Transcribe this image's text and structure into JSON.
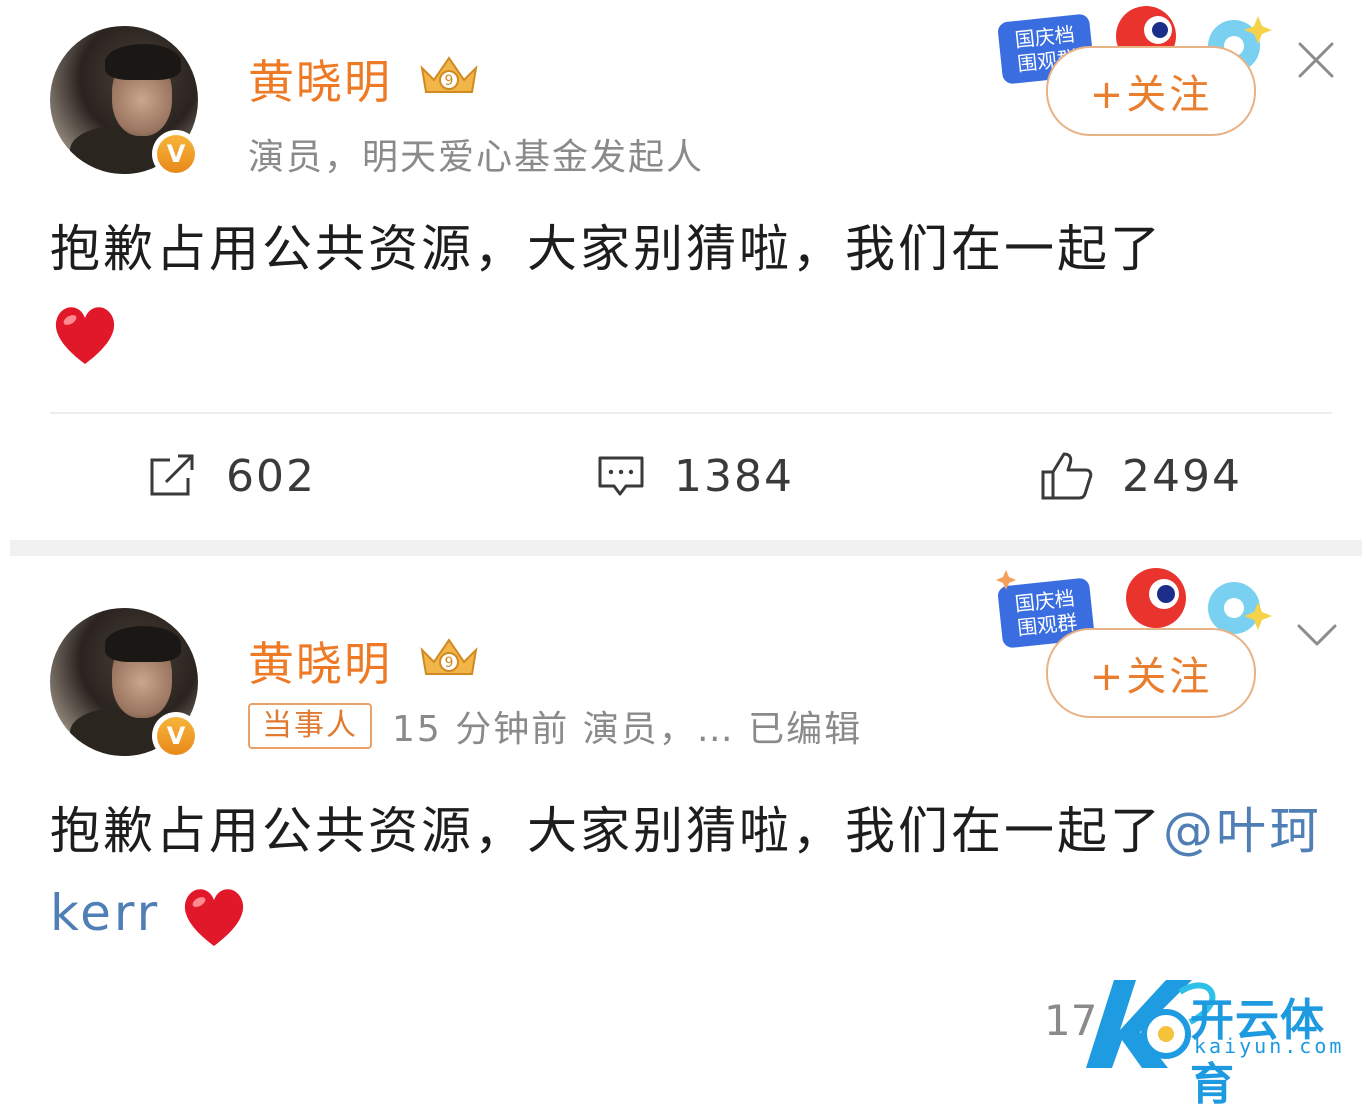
{
  "post1": {
    "username": "黄晓明",
    "bio": "演员，明天爱心基金发起人",
    "follow_label": "+关注",
    "text": "抱歉占用公共资源，大家别猜啦，我们在一起了",
    "actions": {
      "repost_count": "602",
      "comment_count": "1384",
      "like_count": "2494"
    },
    "festival_badge": "国庆档 围观群"
  },
  "post2": {
    "username": "黄晓明",
    "tag": "当事人",
    "meta": "15 分钟前   演员，… 已编辑",
    "follow_label": "+关注",
    "text": "抱歉占用公共资源，大家别猜啦，我们在一起了",
    "mention": "@叶珂 kerr",
    "partial_count": "17",
    "festival_badge": "国庆档 围观群"
  },
  "watermark": {
    "brand": "开云体育",
    "site": "kaiyun.com"
  },
  "colors": {
    "username": "#ee7a25",
    "follow_border": "#e8b287",
    "mention": "#4f7fb5",
    "verified": "#f0a030"
  },
  "icons": [
    "close-icon",
    "chevron-down-icon",
    "repost-icon",
    "comment-icon",
    "like-icon",
    "heart-emoji",
    "crown-vip-icon",
    "verified-v-icon"
  ]
}
